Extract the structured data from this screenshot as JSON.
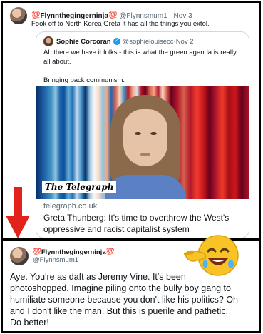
{
  "main_tweet": {
    "display_name": "💯Flynnthegingerninja💯",
    "handle": "@Flynnsmum1",
    "separator": " · ",
    "date": "Nov 3",
    "text": "Fook off to North Korea Greta it has all the things you extol."
  },
  "quoted_tweet": {
    "display_name": "Sophie Corcoran",
    "verified_mark": "✓",
    "handle": "@sophielouisecc",
    "separator": " · ",
    "date": "Nov 2",
    "text_line1": "Ah there we have it folks - this is what the green agenda is really all about.",
    "text_line2": "Bringing back communism.",
    "card": {
      "logo_text": "The Telegraph",
      "domain": "telegraph.co.uk",
      "title": "Greta Thunberg: It's time to overthrow the West's oppressive and racist capitalist system"
    }
  },
  "reply": {
    "display_name": "💯Flynnthegingerninja💯",
    "handle": "@Flynnsmum1",
    "text": "Aye.  You're as daft as Jeremy Vine.  It's been photoshopped.  Imagine piling onto the bully boy gang to humiliate someone because you don't like his politics? Oh and I don't like the man.  But this is puerile and pathetic.  Do better!"
  },
  "colors": {
    "arrow": "#e3231b",
    "verified": "#1d9bf0",
    "secondary_text": "#536471"
  },
  "icons": [
    "red-down-arrow-icon",
    "laughing-pointing-emoji-icon",
    "verified-badge-icon"
  ]
}
